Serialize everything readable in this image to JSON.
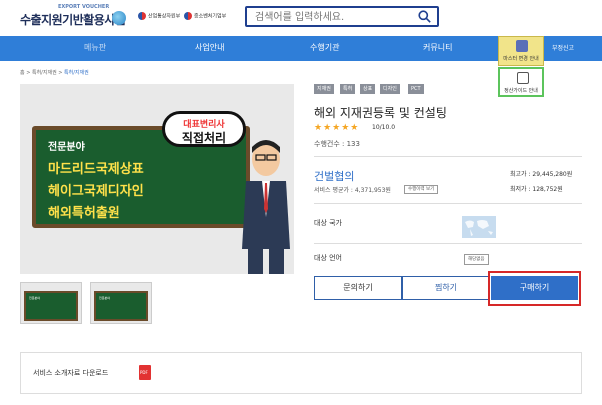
{
  "header": {
    "logo_small": "EXPORT VOUCHER",
    "logo_main": "수출지원기반활용사업",
    "gov_badge_1": "산업통상자원부",
    "gov_badge_2": "중소벤처기업부",
    "search_placeholder": "검색어를 입력하세요."
  },
  "nav": {
    "items": [
      "메뉴판",
      "사업안내",
      "수행기관",
      "커뮤니티"
    ],
    "side_master": "마스터 변경 안내",
    "side_guide": "정산가이드 안내",
    "report": "부정신고"
  },
  "breadcrumb": [
    "홈",
    "특허/지재권",
    "특허/지재권"
  ],
  "image": {
    "label": "전문분야",
    "line1": "마드리드국제상표",
    "line2": "헤이그국제디자인",
    "line3": "해외특허출원",
    "stamp_line1": "대표변리사",
    "stamp_line2": "직접처리",
    "thumb_label": "전문분야"
  },
  "product": {
    "tags": [
      "지재권",
      "특허",
      "상표",
      "디자인",
      "PCT"
    ],
    "title": "해외 지재권등록 및 컨설팅",
    "stars": "★★★★★",
    "rating": "10/10.0",
    "count": "수행건수 : 133",
    "company": "건벌협의",
    "avg_price": "서비스 평균가 : 4,371,953원",
    "history_btn": "수행이력 보기",
    "max_price": "최고가 : 29,445,280원",
    "min_price": "최저가 : 128,752원",
    "target_country_label": "대상 국가",
    "target_lang_label": "대상 언어",
    "lang_value": "해당없음"
  },
  "actions": {
    "inquiry": "문의하기",
    "wishlist": "찜하기",
    "buy": "구매하기"
  },
  "download": {
    "label": "서비스 소개자료 다운로드",
    "file_type": "PDF"
  },
  "colors": {
    "nav_blue": "#2f7ed8",
    "buy_blue": "#2f6fc8",
    "highlight_red": "#d62828",
    "board_green": "#1a5d2e"
  }
}
